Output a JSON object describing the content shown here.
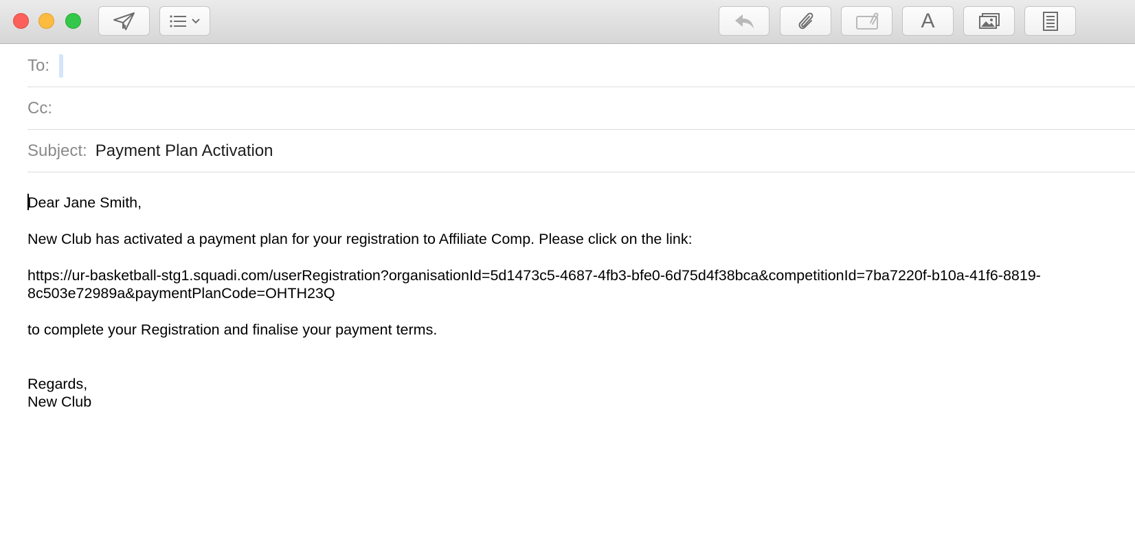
{
  "toolbar": {
    "send_icon": "paper-plane-icon",
    "header_fields_icon": "list-icon",
    "reply_icon": "reply-arrow-icon",
    "attach_icon": "paperclip-icon",
    "markup_icon": "markup-attachment-icon",
    "format_label": "A",
    "photo_icon": "photo-browser-icon",
    "stationery_icon": "stationery-icon"
  },
  "header": {
    "to_label": "To:",
    "to_value": "",
    "cc_label": "Cc:",
    "cc_value": "",
    "subject_label": "Subject:",
    "subject_value": "Payment Plan Activation"
  },
  "message": {
    "greeting": "Dear Jane Smith,",
    "intro": "New Club has activated a payment plan for your registration to Affiliate Comp. Please click on the link:",
    "link": "https://ur-basketball-stg1.squadi.com/userRegistration?organisationId=5d1473c5-4687-4fb3-bfe0-6d75d4f38bca&competitionId=7ba7220f-b10a-41f6-8819-8c503e72989a&paymentPlanCode=OHTH23Q",
    "instruction": "to complete your Registration and finalise your payment terms.",
    "closing": "Regards,",
    "signature": "New Club"
  },
  "colors": {
    "close": "#fc605b",
    "minimize": "#fdbc40",
    "zoom": "#34c84a",
    "label_gray": "#8a8a8a",
    "selection_blue": "#d3e5fb"
  }
}
